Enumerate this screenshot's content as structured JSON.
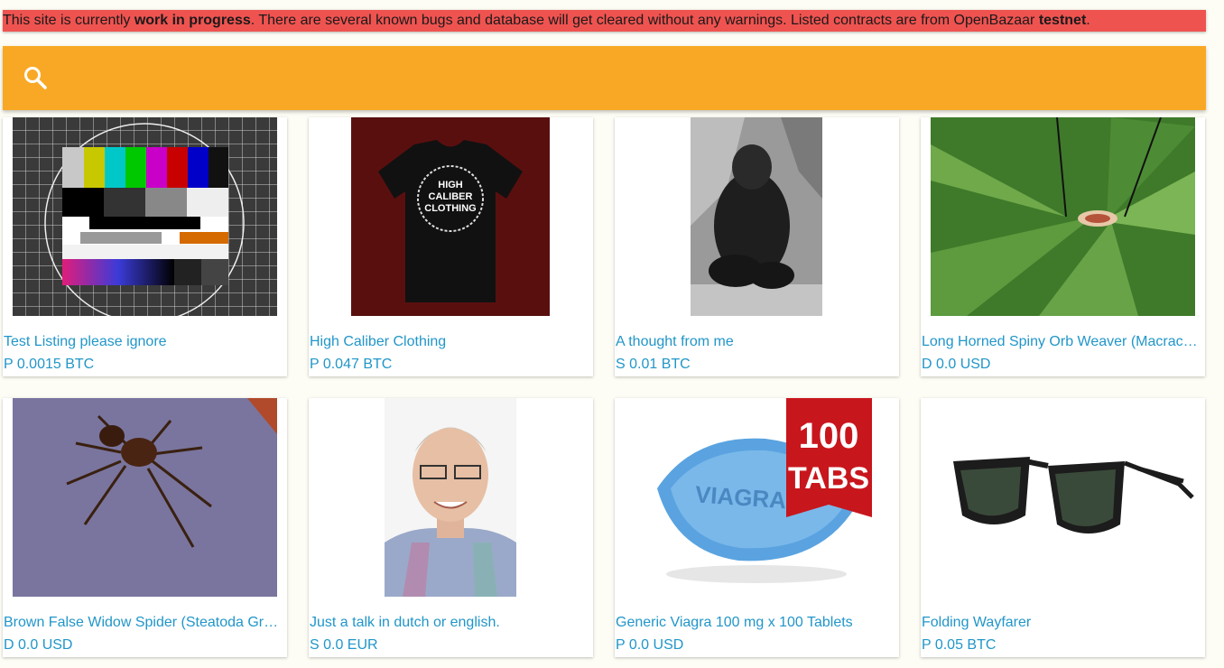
{
  "banner": {
    "part1": "This site is currently ",
    "bold1": "work in progress",
    "part2": ". There are several known bugs and database will get cleared without any warnings. Listed contracts are from OpenBazaar ",
    "bold2": "testnet",
    "part3": "."
  },
  "search": {
    "icon": "search-icon",
    "placeholder": "",
    "value": ""
  },
  "colors": {
    "banner": "#ef5350",
    "search_bar": "#f9a825",
    "link": "#2196c9"
  },
  "listings": [
    {
      "title": "Test Listing please ignore",
      "price": "P 0.0015 BTC",
      "image": "tv-test-pattern"
    },
    {
      "title": "High Caliber Clothing",
      "price": "P 0.047 BTC",
      "image": "black-tshirt"
    },
    {
      "title": "A thought from me",
      "price": "S 0.01 BTC",
      "image": "gorilla-photo"
    },
    {
      "title": "Long Horned Spiny Orb Weaver (Macracantha arcuata)",
      "price": "D 0.0 USD",
      "image": "spider-on-leaf"
    },
    {
      "title": "Brown False Widow Spider (Steatoda Grossa)",
      "price": "D 0.0 USD",
      "image": "brown-spider"
    },
    {
      "title": "Just a talk in dutch or english.",
      "price": "S 0.0 EUR",
      "image": "man-portrait"
    },
    {
      "title": "Generic Viagra 100 mg x 100 Tablets",
      "price": "P 0.0 USD",
      "image": "blue-pill"
    },
    {
      "title": "Folding Wayfarer",
      "price": "P 0.05 BTC",
      "image": "sunglasses"
    }
  ],
  "image_text": {
    "tshirt_logo": [
      "HIGH",
      "CALIBER",
      "CLOTHING"
    ],
    "pill_label": "VIAGRA",
    "badge": [
      "100",
      "TABS"
    ]
  }
}
